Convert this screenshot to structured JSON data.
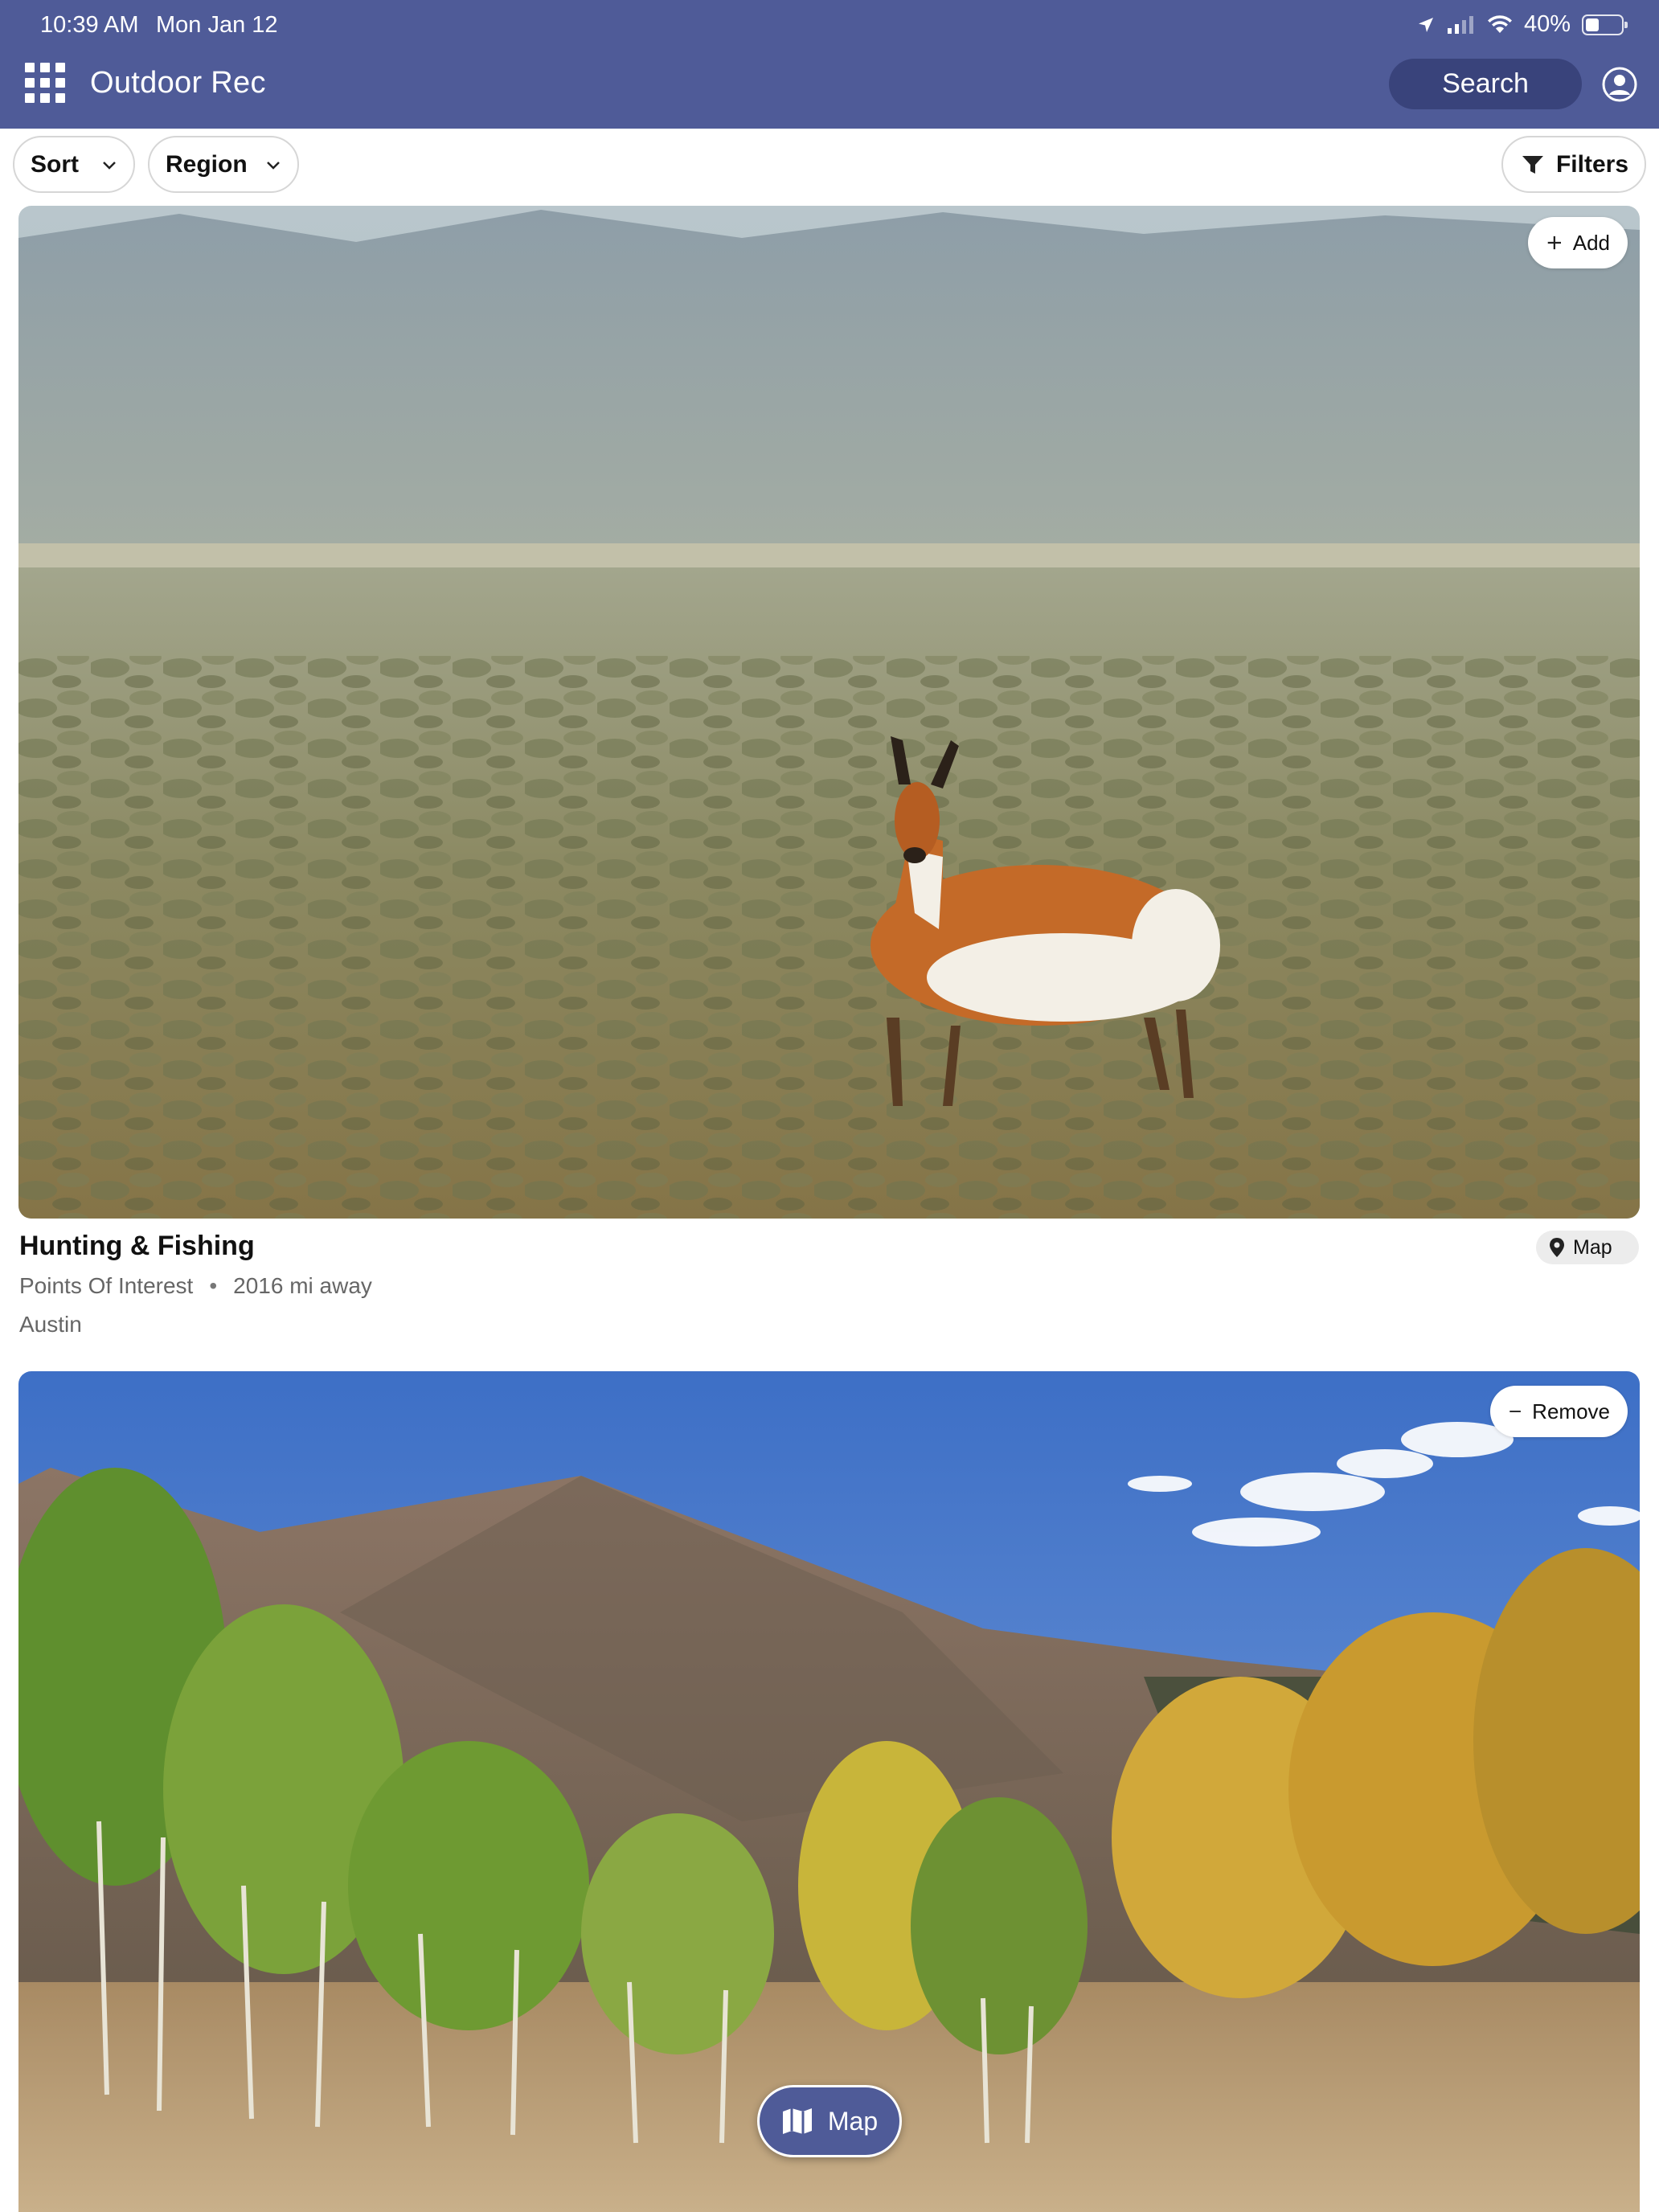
{
  "status_bar": {
    "time": "10:39 AM",
    "date": "Mon Jan 12",
    "battery": "40%",
    "battery_level": 0.4,
    "icons": [
      "location-arrow-icon",
      "cellular-signal-icon",
      "wifi-icon",
      "battery-icon"
    ]
  },
  "header": {
    "title": "Outdoor Rec",
    "search_label": "Search",
    "menu_icon": "apps-grid-icon",
    "account_icon": "account-icon",
    "background": "#4f5b98"
  },
  "filters": {
    "sort_label": "Sort",
    "region_label": "Region",
    "filters_label": "Filters"
  },
  "cards": [
    {
      "title": "Hunting & Fishing",
      "category": "Points Of Interest",
      "distance": "2016 mi away",
      "city": "Austin",
      "action_label": "Add",
      "map_label": "Map",
      "image": "pronghorn antelope standing in sagebrush plain with mountains behind"
    },
    {
      "action_label": "Remove",
      "image": "mountain peak with aspen trees in autumn colors under blue sky"
    }
  ],
  "floating": {
    "map_label": "Map"
  }
}
